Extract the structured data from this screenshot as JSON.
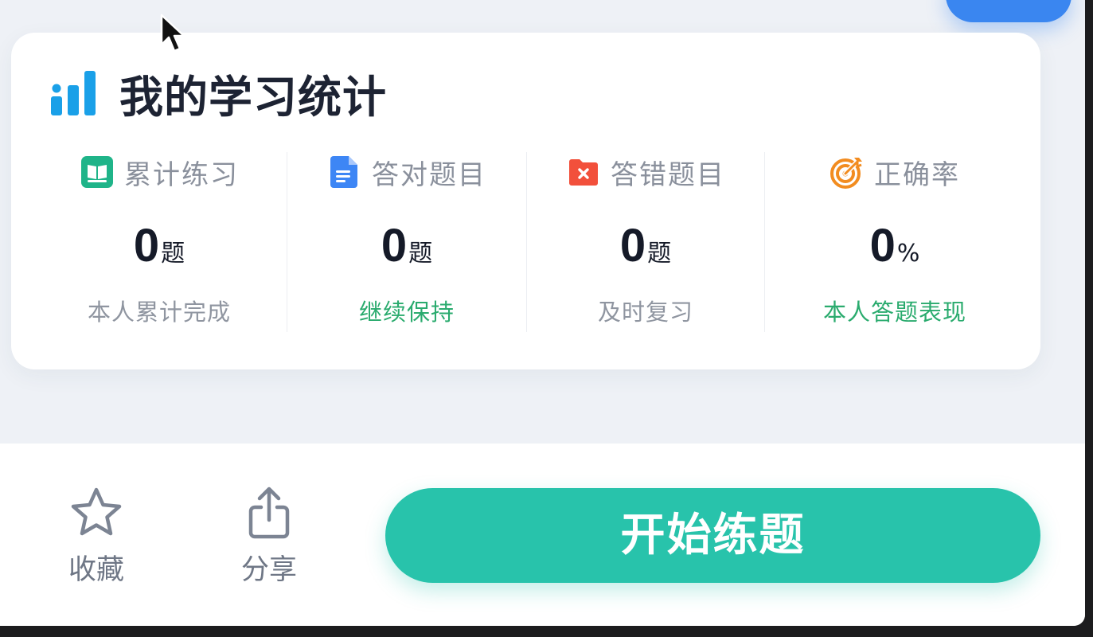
{
  "stats": {
    "title": "我的学习统计",
    "title_icon": "bar-chart-icon",
    "accent_color": "#1aa0e8",
    "items": [
      {
        "label": "累计练习",
        "icon": "book-icon",
        "icon_color": "#1fb489",
        "value": "0",
        "unit": "题",
        "sub": "本人累计完成",
        "sub_color": "#8f95a0"
      },
      {
        "label": "答对题目",
        "icon": "document-icon",
        "icon_color": "#3d86f5",
        "value": "0",
        "unit": "题",
        "sub": "继续保持",
        "sub_color": "#2aab6e"
      },
      {
        "label": "答错题目",
        "icon": "error-folder-icon",
        "icon_color": "#f2503b",
        "value": "0",
        "unit": "题",
        "sub": "及时复习",
        "sub_color": "#8f95a0"
      },
      {
        "label": "正确率",
        "icon": "target-icon",
        "icon_color": "#f28c20",
        "value": "0",
        "unit": "%",
        "sub": "本人答题表现",
        "sub_color": "#2aab6e"
      }
    ]
  },
  "bottom_bar": {
    "favorite_label": "收藏",
    "favorite_icon": "star-icon",
    "share_label": "分享",
    "share_icon": "share-icon",
    "start_label": "开始练题",
    "start_color": "#28c3ab"
  }
}
